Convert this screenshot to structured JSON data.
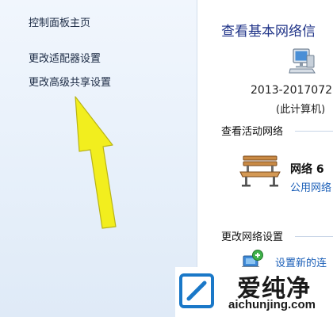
{
  "sidebar": {
    "items": [
      {
        "label": "控制面板主页"
      },
      {
        "label": "更改适配器设置"
      },
      {
        "label": "更改高级共享设置"
      }
    ]
  },
  "main": {
    "title": "查看基本网络信",
    "computer_name": "2013-2017072",
    "computer_subtitle": "(此计算机)",
    "active_networks_heading": "查看活动网络",
    "network": {
      "name": "网络  6",
      "type": "公用网络",
      "icon": "bench-icon"
    },
    "change_settings_heading": "更改网络设置",
    "setup_link": "设置新的连"
  },
  "watermark": {
    "text": "爱纯净",
    "url": "aichunjing.com"
  },
  "colors": {
    "title_blue": "#1e3287",
    "link_blue": "#1b5fb8",
    "arrow_yellow": "#f2ee1e",
    "sidebar_bg": "#e7f0fa"
  }
}
